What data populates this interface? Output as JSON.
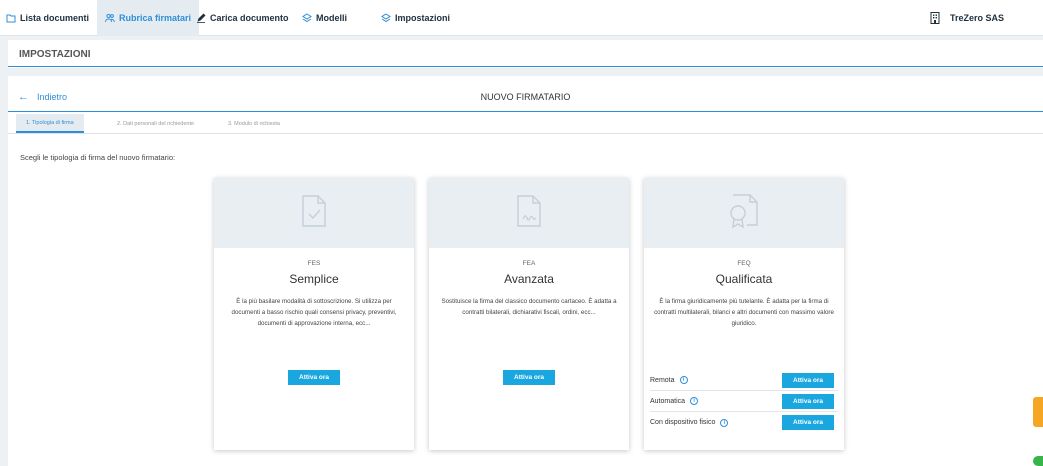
{
  "nav": {
    "items": [
      {
        "label": "Lista documenti",
        "icon": "folder-icon",
        "active": false
      },
      {
        "label": "Rubrica firmatari",
        "icon": "users-icon",
        "active": true
      },
      {
        "label": "Carica documento",
        "icon": "pen-icon",
        "active": false
      },
      {
        "label": "Modelli",
        "icon": "layers-icon",
        "active": false
      },
      {
        "label": "Impostazioni",
        "icon": "settings-icon",
        "active": false
      }
    ],
    "company": "TreZero SAS"
  },
  "section": {
    "title": "IMPOSTAZIONI"
  },
  "form": {
    "back_label": "Indietro",
    "title": "NUOVO FIRMATARIO",
    "steps": [
      {
        "label": "1. Tipologia di firma",
        "active": true
      },
      {
        "label": "2. Dati personali del richiedente",
        "active": false
      },
      {
        "label": "3. Modulo di richiesta",
        "active": false
      }
    ],
    "instruction": "Scegli le tipologia di firma del nuovo firmatario:"
  },
  "cards": [
    {
      "code": "FES",
      "name": "Semplice",
      "description": "È la più basilare modalità di sottoscrizione. Si utilizza per documenti a basso rischio quali consensi privacy, preventivi, documenti di approvazione interna, ecc...",
      "button": "Attiva ora"
    },
    {
      "code": "FEA",
      "name": "Avanzata",
      "description": "Sostituisce la firma del classico documento cartaceo. È adatta a contratti bilaterali, dichiarativi fiscali, ordini, ecc...",
      "button": "Attiva ora"
    },
    {
      "code": "FEQ",
      "name": "Qualificata",
      "description": "È la firma giuridicamente più tutelante. È adatta per la firma di contratti multilaterali, bilanci e altri documenti con massimo valore giuridico.",
      "options": [
        {
          "label": "Remota",
          "button": "Attiva ora"
        },
        {
          "label": "Automatica",
          "button": "Attiva ora"
        },
        {
          "label": "Con dispositivo fisico",
          "button": "Attiva ora"
        }
      ]
    }
  ],
  "colors": {
    "accent": "#2f8fd8",
    "button": "#1aa6df",
    "background": "#eef1f4"
  }
}
